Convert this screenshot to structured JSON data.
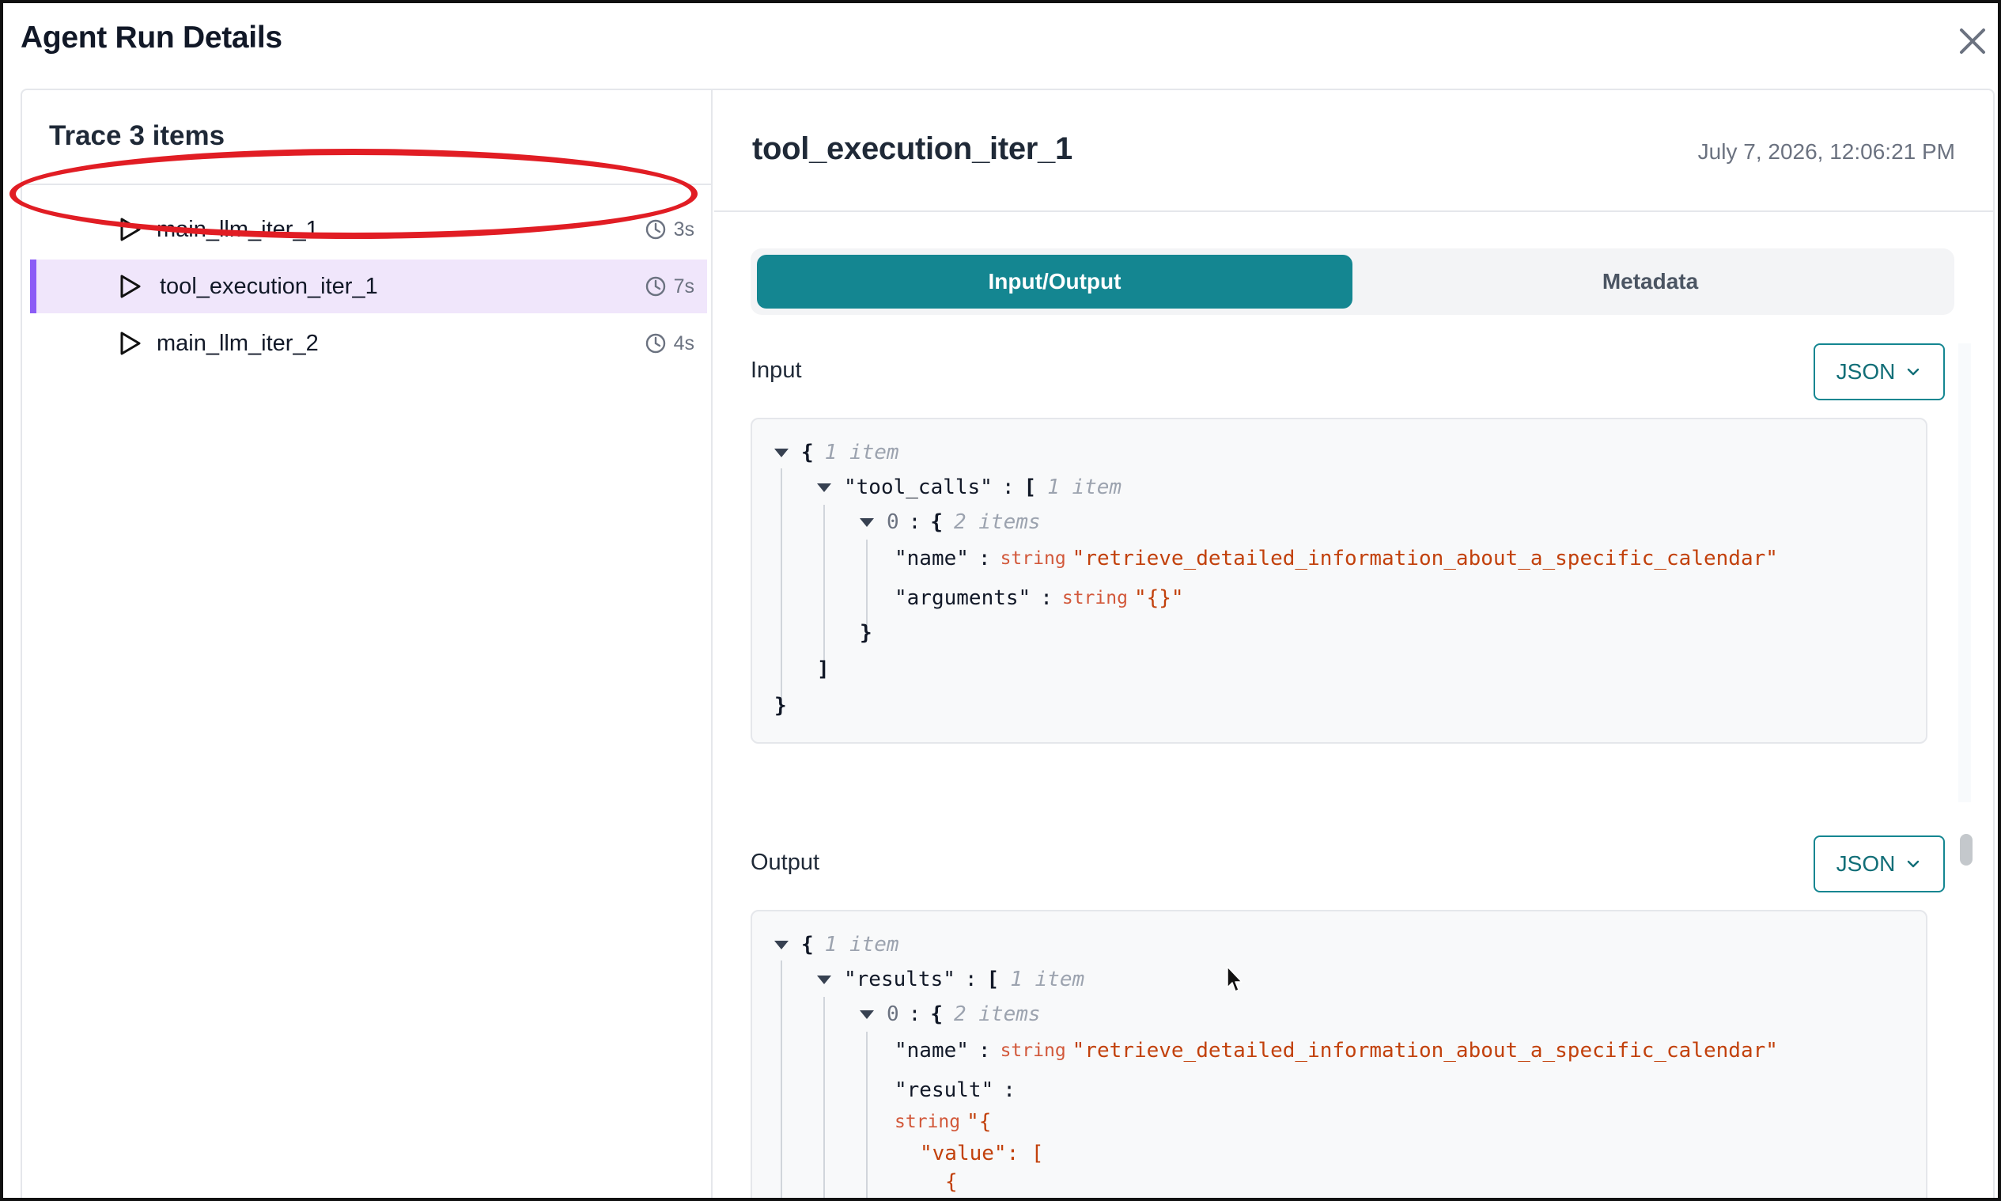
{
  "modal": {
    "title": "Agent Run Details"
  },
  "trace": {
    "header_label": "Trace",
    "header_count": "3 items",
    "items": [
      {
        "label": "main_llm_iter_1",
        "duration": "3s"
      },
      {
        "label": "tool_execution_iter_1",
        "duration": "7s",
        "selected": true
      },
      {
        "label": "main_llm_iter_2",
        "duration": "4s"
      }
    ]
  },
  "detail": {
    "title": "tool_execution_iter_1",
    "timestamp": "July 7, 2026, 12:06:21 PM",
    "tabs": [
      {
        "label": "Input/Output",
        "active": true
      },
      {
        "label": "Metadata",
        "active": false
      }
    ],
    "input": {
      "label": "Input",
      "format": "JSON",
      "root_meta": "1 item",
      "tool_calls_key": "\"tool_calls\"",
      "tool_calls_meta": "1 item",
      "index": "0",
      "index_meta": "2 items",
      "name_key": "\"name\"",
      "name_type": "string",
      "name_value": "\"retrieve_detailed_information_about_a_specific_calendar\"",
      "arguments_key": "\"arguments\"",
      "arguments_type": "string",
      "arguments_value": "\"{}\""
    },
    "output": {
      "label": "Output",
      "format": "JSON",
      "root_meta": "1 item",
      "results_key": "\"results\"",
      "results_meta": "1 item",
      "index": "0",
      "index_meta": "2 items",
      "name_key": "\"name\"",
      "name_type": "string",
      "name_value": "\"retrieve_detailed_information_about_a_specific_calendar\"",
      "result_key": "\"result\"",
      "result_type": "string",
      "result_value_line1": "\"{",
      "result_value_line2": "\"value\": [",
      "result_value_line3": "{"
    }
  },
  "colors": {
    "accent": "#148691",
    "selected_bg": "#f0e6fb",
    "selected_bar": "#8b5cf6",
    "annotation": "#e11d24",
    "string_value": "#c2410c"
  }
}
